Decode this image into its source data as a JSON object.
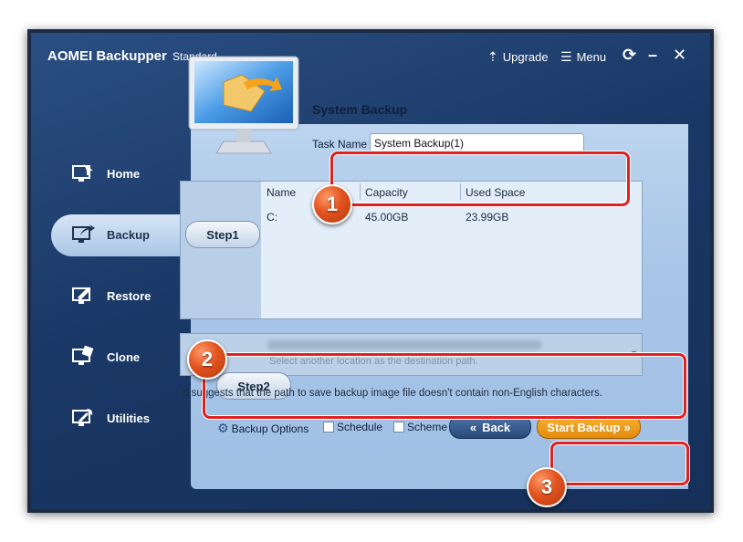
{
  "app": {
    "title": "AOMEI Backupper",
    "edition": "Standard"
  },
  "toolbar": {
    "upgrade": "Upgrade",
    "menu": "Menu"
  },
  "sidebar": {
    "items": [
      {
        "label": "Home"
      },
      {
        "label": "Backup"
      },
      {
        "label": "Restore"
      },
      {
        "label": "Clone"
      },
      {
        "label": "Utilities"
      }
    ]
  },
  "main": {
    "title": "System Backup",
    "task_name_label": "Task Name",
    "task_name_value": "System Backup(1)",
    "step1": {
      "label": "Step1",
      "columns": [
        "Name",
        "Capacity",
        "Used Space"
      ],
      "rows": [
        {
          "name": "C:",
          "capacity": "45.00GB",
          "used": "23.99GB"
        }
      ]
    },
    "step2": {
      "label": "Step2",
      "hint": "Select another location as the destination path."
    },
    "note": "It suggests that the path to save backup image file doesn't contain non-English characters.",
    "options": {
      "backup_options": "Backup Options",
      "schedule": "Schedule",
      "scheme": "Scheme"
    },
    "back": "Back",
    "start": "Start Backup"
  },
  "markers": [
    "1",
    "2",
    "3"
  ],
  "colors": {
    "highlight": "#e02020",
    "start_button": "#f0a020",
    "marker": "#e2531e"
  }
}
